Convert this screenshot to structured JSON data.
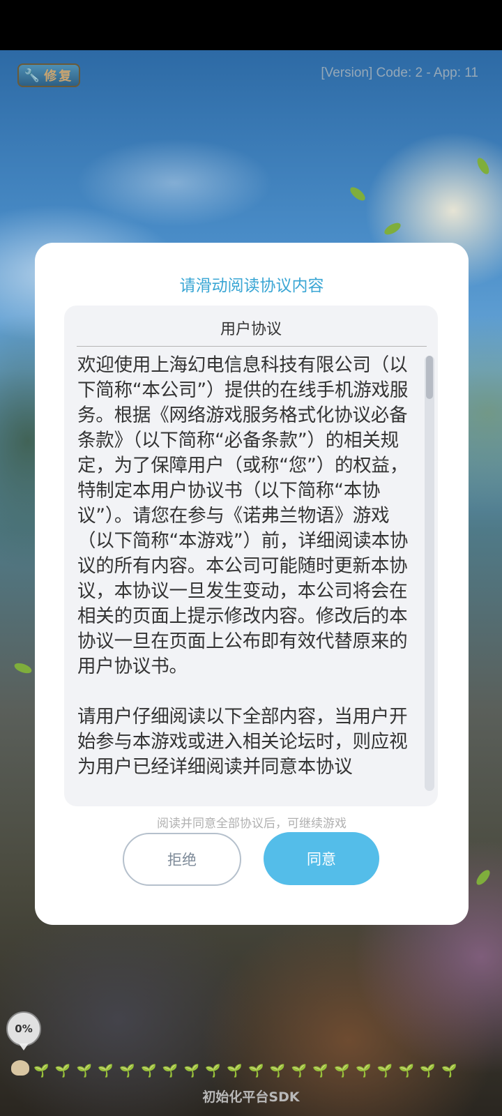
{
  "top_bar": {
    "repair_button_label": "修复",
    "version_text": "[Version] Code: 2 - App: 11"
  },
  "dialog": {
    "title": "请滑动阅读协议内容",
    "agreement_title": "用户协议",
    "agreement_text": "欢迎使用上海幻电信息科技有限公司（以下简称“本公司”）提供的在线手机游戏服务。根据《网络游戏服务格式化协议必备条款》（以下简称“必备条款”）的相关规定，为了保障用户（或称“您”）的权益，特制定本用户协议书（以下简称“本协议”）。请您在参与《诺弗兰物语》游戏（以下简称“本游戏”）前，详细阅读本协议的所有内容。本公司可能随时更新本协议，本协议一旦发生变动，本公司将会在相关的页面上提示修改内容。修改后的本协议一旦在页面上公布即有效代替原来的用户协议书。\n\n请用户仔细阅读以下全部内容，当用户开始参与本游戏或进入相关论坛时，则应视为用户已经详细阅读并同意本协议",
    "hint": "阅读并同意全部协议后，可继续游戏",
    "reject_label": "拒绝",
    "agree_label": "同意",
    "agree_color": "#54bde9",
    "title_color": "#3aa6d4"
  },
  "loading": {
    "percent": "0%",
    "progress_value": 0,
    "footer_label": "初始化平台SDK"
  }
}
